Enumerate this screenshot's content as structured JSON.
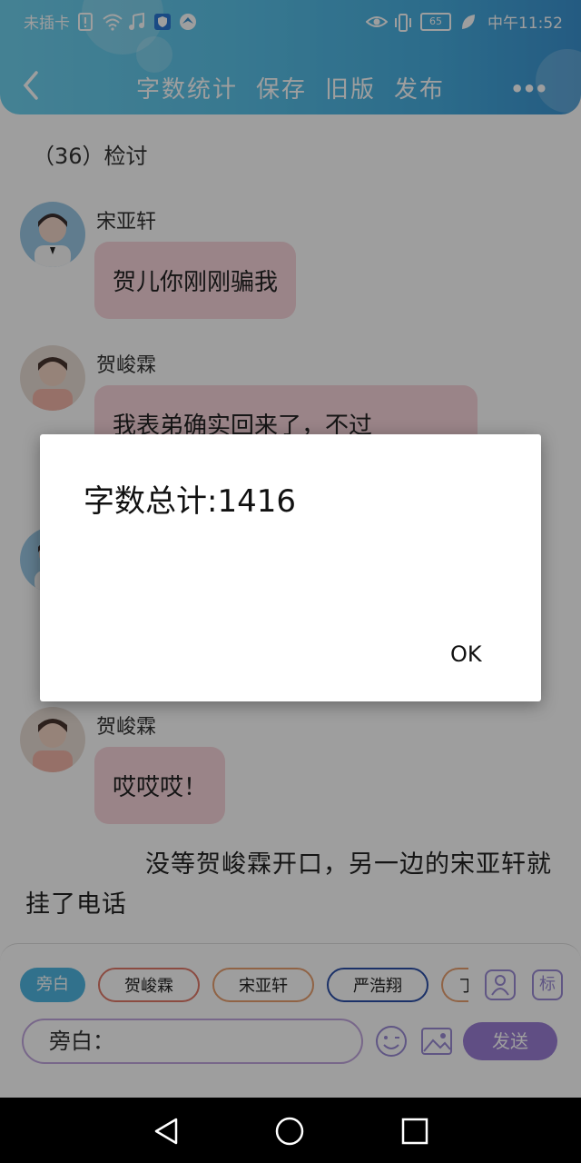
{
  "status_bar": {
    "carrier": "未插卡",
    "battery": "65",
    "time": "中午11:52",
    "icons": [
      "sim-alert-icon",
      "wifi-icon",
      "music-icon",
      "shield-icon",
      "browser-icon",
      "eye-icon",
      "vibrate-icon",
      "leaf-icon"
    ]
  },
  "toolbar": {
    "word_count": "字数统计",
    "save": "保存",
    "old_version": "旧版",
    "publish": "发布",
    "more": "•••"
  },
  "chapter_title": "（36）检讨",
  "messages": [
    {
      "name": "宋亚轩",
      "text": "贺儿你刚刚骗我"
    },
    {
      "name": "贺峻霖",
      "text": "我表弟确实回来了，不过"
    },
    {
      "name": "贺峻霖",
      "text": "哎哎哎！"
    }
  ],
  "narration": "没等贺峻霖开口，另一边的宋亚轩就挂了电话",
  "roles": {
    "selected": "旁白",
    "items": [
      "旁白",
      "贺峻霖",
      "宋亚轩",
      "严浩翔",
      "丁"
    ]
  },
  "role_icons": {
    "person": "person-icon",
    "tag": "标"
  },
  "composer": {
    "value": "旁白：",
    "send": "发送"
  },
  "dialog": {
    "message": "字数总计:1416",
    "ok": "OK"
  },
  "colors": {
    "appbar_start": "#6fd1ee",
    "appbar_end": "#3b93d1",
    "bubble": "#f8d6dc",
    "accent": "#9b7fd6"
  }
}
